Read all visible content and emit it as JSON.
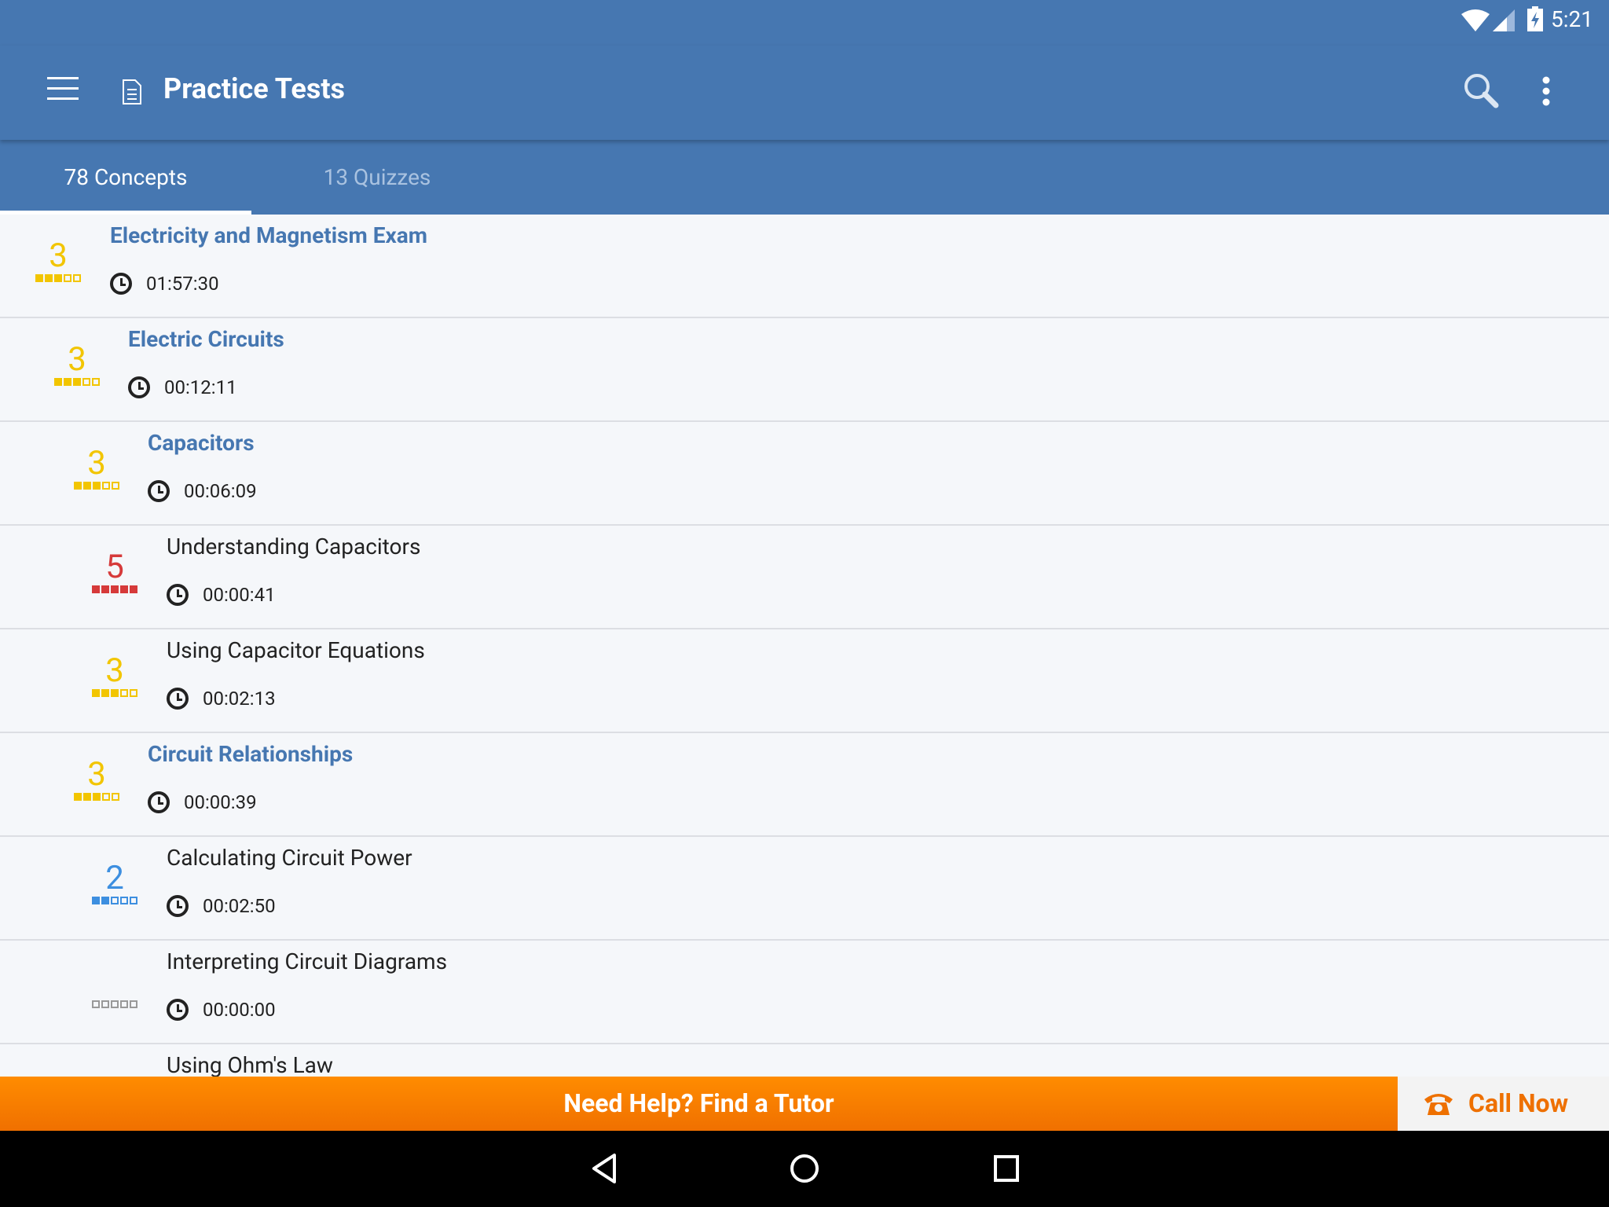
{
  "status_bar": {
    "time": "5:21",
    "icons": [
      "wifi-icon",
      "signal-icon",
      "battery-charging-icon"
    ]
  },
  "app_bar": {
    "title": "Practice Tests",
    "icons": [
      "menu-icon",
      "document-icon",
      "search-icon",
      "more-vert-icon"
    ]
  },
  "tabs": [
    {
      "label": "78 Concepts",
      "active": true
    },
    {
      "label": "13 Quizzes",
      "active": false
    }
  ],
  "items": [
    {
      "title": "Electricity and Magnetism Exam",
      "time": "01:57:30",
      "score": "3",
      "level": 0,
      "heading": true,
      "color": "#f2c500",
      "filled": 3
    },
    {
      "title": "Electric Circuits",
      "time": "00:12:11",
      "score": "3",
      "level": 1,
      "heading": true,
      "color": "#f2c500",
      "filled": 3
    },
    {
      "title": "Capacitors",
      "time": "00:06:09",
      "score": "3",
      "level": 2,
      "heading": true,
      "color": "#f2c500",
      "filled": 3
    },
    {
      "title": "Understanding Capacitors",
      "time": "00:00:41",
      "score": "5",
      "level": 3,
      "heading": false,
      "color": "#d63a3a",
      "filled": 5
    },
    {
      "title": "Using Capacitor Equations",
      "time": "00:02:13",
      "score": "3",
      "level": 3,
      "heading": false,
      "color": "#f2c500",
      "filled": 3
    },
    {
      "title": "Circuit Relationships",
      "time": "00:00:39",
      "score": "3",
      "level": 2,
      "heading": true,
      "color": "#f2c500",
      "filled": 3
    },
    {
      "title": "Calculating Circuit Power",
      "time": "00:02:50",
      "score": "2",
      "level": 3,
      "heading": false,
      "color": "#3d8fe0",
      "filled": 2
    },
    {
      "title": "Interpreting Circuit Diagrams",
      "time": "00:00:00",
      "score": "",
      "level": 3,
      "heading": false,
      "color": "#999999",
      "filled": 0
    },
    {
      "title": "Using Ohm's Law",
      "time": "",
      "score": "",
      "level": 3,
      "heading": false,
      "color": "#f2c500",
      "filled": 0
    }
  ],
  "banner": {
    "label": "Need Help? Find a Tutor",
    "call_label": "Call Now",
    "accent": "#f98200"
  },
  "nav_bar": {
    "icons": [
      "back-icon",
      "home-icon",
      "recents-icon"
    ]
  }
}
